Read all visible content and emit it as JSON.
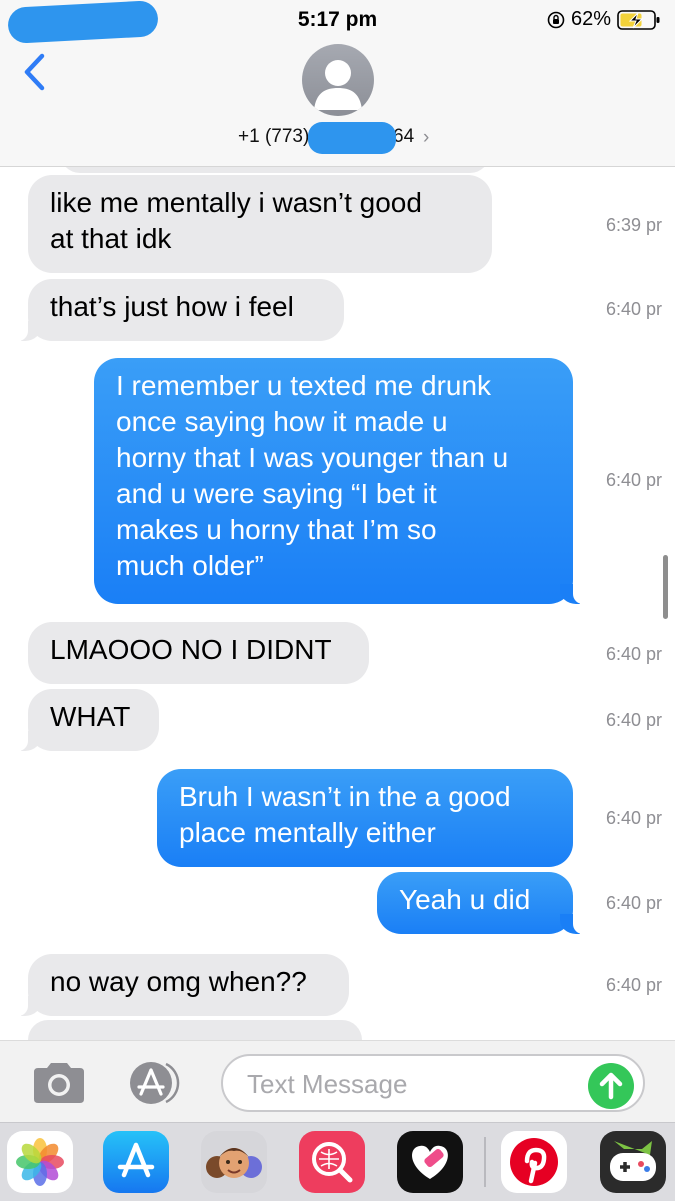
{
  "status_bar": {
    "time": "5:17 pm",
    "battery_percent": "62%"
  },
  "contact": {
    "number_prefix": "+1 (773)",
    "number_suffix": "64",
    "chevron": "›"
  },
  "messages": [
    {
      "side": "received",
      "text": "like me mentally i wasn’t good\nat that idk",
      "time": "6:39 pr"
    },
    {
      "side": "received",
      "text": "that’s just how i feel",
      "time": "6:40 pr"
    },
    {
      "side": "sent",
      "text": "I remember u texted me drunk\nonce saying how it made u\nhorny that I was younger than u\nand u were saying “I bet it\nmakes u horny that I’m so\nmuch older”",
      "time": "6:40 pr"
    },
    {
      "side": "received",
      "text": "LMAOOO NO I DIDNT",
      "time": "6:40 pr"
    },
    {
      "side": "received",
      "text": "WHAT",
      "time": "6:40 pr"
    },
    {
      "side": "sent",
      "text": "Bruh I wasn’t in the a good\nplace mentally either",
      "time": "6:40 pr"
    },
    {
      "side": "sent",
      "text": "Yeah u did",
      "time": "6:40 pr"
    },
    {
      "side": "received",
      "text": "no way omg when??",
      "time": "6:40 pr"
    }
  ],
  "input": {
    "placeholder": "Text Message"
  },
  "icons": {
    "back": "chevron-left-icon",
    "camera": "camera-icon",
    "apps": "app-store-icon",
    "send": "arrow-up-icon"
  },
  "app_drawer": [
    "photos",
    "app-store",
    "memoji",
    "search",
    "heart-app",
    "pinterest",
    "game-app"
  ],
  "colors": {
    "sent_bubble": "#1a7ff6",
    "received_bubble": "#e9e9eb",
    "accent": "#2f7cf6",
    "send_button": "#34c759"
  }
}
